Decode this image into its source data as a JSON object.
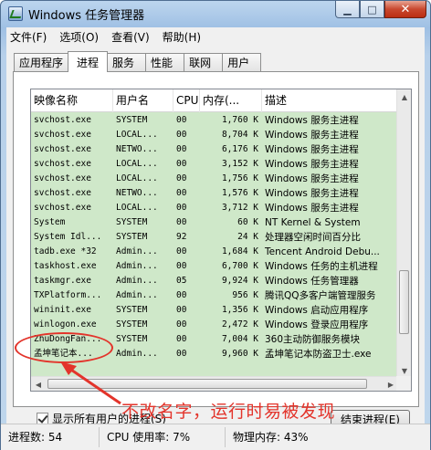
{
  "window": {
    "title": "Windows 任务管理器"
  },
  "menu": [
    "文件(F)",
    "选项(O)",
    "查看(V)",
    "帮助(H)"
  ],
  "tabs": [
    "应用程序",
    "进程",
    "服务",
    "性能",
    "联网",
    "用户"
  ],
  "active_tab": "进程",
  "columns": [
    "映像名称",
    "用户名",
    "CPU",
    "内存(...",
    "描述"
  ],
  "rows": [
    [
      "svchost.exe",
      "SYSTEM",
      "00",
      "1,760 K",
      "Windows 服务主进程"
    ],
    [
      "svchost.exe",
      "LOCAL...",
      "00",
      "8,704 K",
      "Windows 服务主进程"
    ],
    [
      "svchost.exe",
      "NETWO...",
      "00",
      "6,176 K",
      "Windows 服务主进程"
    ],
    [
      "svchost.exe",
      "LOCAL...",
      "00",
      "3,152 K",
      "Windows 服务主进程"
    ],
    [
      "svchost.exe",
      "LOCAL...",
      "00",
      "1,756 K",
      "Windows 服务主进程"
    ],
    [
      "svchost.exe",
      "NETWO...",
      "00",
      "1,576 K",
      "Windows 服务主进程"
    ],
    [
      "svchost.exe",
      "LOCAL...",
      "00",
      "3,712 K",
      "Windows 服务主进程"
    ],
    [
      "System",
      "SYSTEM",
      "00",
      "60 K",
      "NT Kernel & System"
    ],
    [
      "System Idl...",
      "SYSTEM",
      "92",
      "24 K",
      "处理器空闲时间百分比"
    ],
    [
      "tadb.exe *32",
      "Admin...",
      "00",
      "1,684 K",
      "Tencent Android Debu..."
    ],
    [
      "taskhost.exe",
      "Admin...",
      "00",
      "6,700 K",
      "Windows 任务的主机进程"
    ],
    [
      "taskmgr.exe",
      "Admin...",
      "05",
      "9,924 K",
      "Windows 任务管理器"
    ],
    [
      "TXPlatform...",
      "Admin...",
      "00",
      "956 K",
      "腾讯QQ多客户端管理服务"
    ],
    [
      "wininit.exe",
      "SYSTEM",
      "00",
      "1,356 K",
      "Windows 启动应用程序"
    ],
    [
      "winlogon.exe",
      "SYSTEM",
      "00",
      "2,472 K",
      "Windows 登录应用程序"
    ],
    [
      "ZhuDongFan...",
      "SYSTEM",
      "00",
      "7,004 K",
      "360主动防御服务模块"
    ],
    [
      "孟坤笔记本...",
      "Admin...",
      "00",
      "9,960 K",
      "孟坤笔记本防盗卫士.exe"
    ]
  ],
  "show_all_label": "显示所有用户的进程(S)",
  "show_all_checked": true,
  "end_process_label": "结束进程(E)",
  "status": {
    "processes": "进程数: 54",
    "cpu": "CPU 使用率: 7%",
    "memory": "物理内存: 43%"
  },
  "annotation": "不改名字，运行时易被发现",
  "colors": {
    "list_bg": "#cfe8c9",
    "annotation": "#e3342b"
  },
  "vertical_scroll_fraction": 0.85
}
